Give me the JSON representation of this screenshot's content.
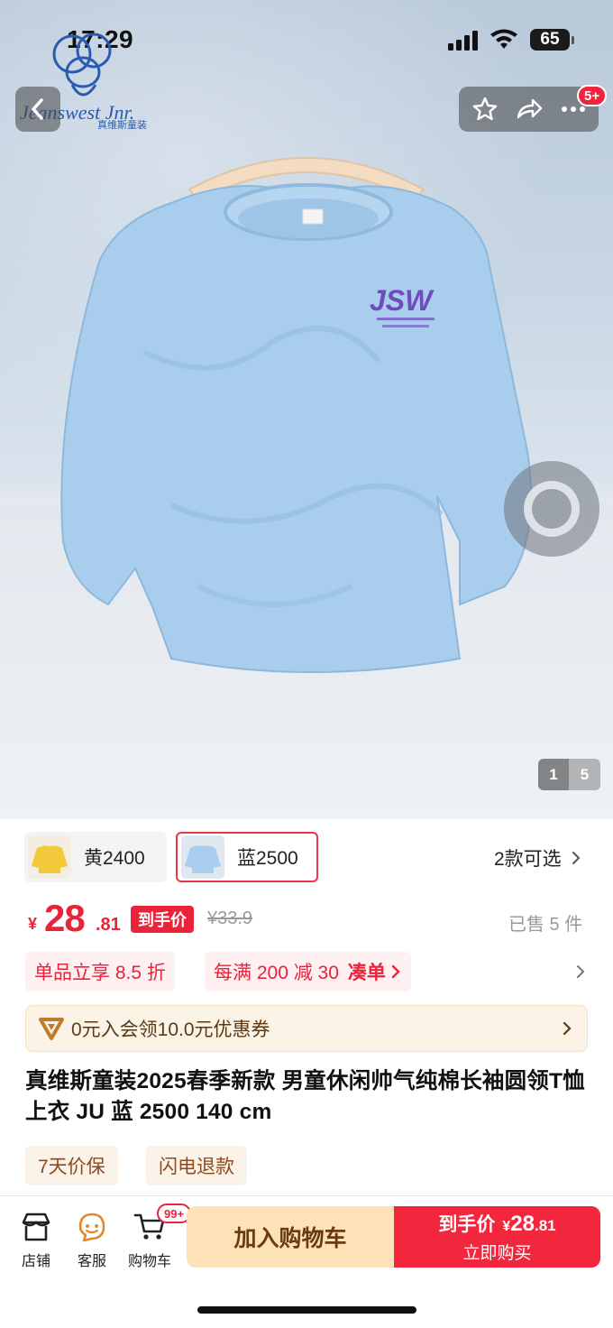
{
  "status_bar": {
    "time": "17:29",
    "battery": "65"
  },
  "brand": {
    "name": "Jeanswest Jnr.",
    "sub": "真维斯童装"
  },
  "shirt_print": {
    "logo": "JSW"
  },
  "header": {
    "notification_badge": "5+"
  },
  "gallery": {
    "current": "1",
    "total": "5"
  },
  "variants": {
    "items": [
      {
        "label": "黄2400",
        "color": "#f2c93a",
        "selected": false
      },
      {
        "label": "蓝2500",
        "color": "#a9cdec",
        "selected": true
      }
    ],
    "more_label": "2款可选"
  },
  "price": {
    "currency": "¥",
    "integer": "28",
    "decimal": ".81",
    "tag": "到手价",
    "original": "¥33.9",
    "sold": "已售 5 件"
  },
  "promos": {
    "discount": "单品立享 8.5 折",
    "threshold": "每满 200 减 30",
    "threshold_action": "凑单"
  },
  "coupon": {
    "text": "0元入会领10.0元优惠券"
  },
  "product": {
    "title": "真维斯童装2025春季新款 男童休闲帅气纯棉长袖圆领T恤上衣 JU 蓝 2500 140 cm"
  },
  "services": [
    "7天价保",
    "闪电退款"
  ],
  "bottom_bar": {
    "store_label": "店铺",
    "service_label": "客服",
    "cart_label": "购物车",
    "cart_badge": "99+",
    "add_to_cart": "加入购物车",
    "buy_price_label": "到手价",
    "buy_currency": "¥",
    "buy_price_int": "28",
    "buy_price_dec": ".81",
    "buy_now": "立即购买"
  },
  "colors": {
    "accent_red": "#e8233a",
    "cart_button": "#fde2b8",
    "shirt_blue": "#a9cdec"
  }
}
